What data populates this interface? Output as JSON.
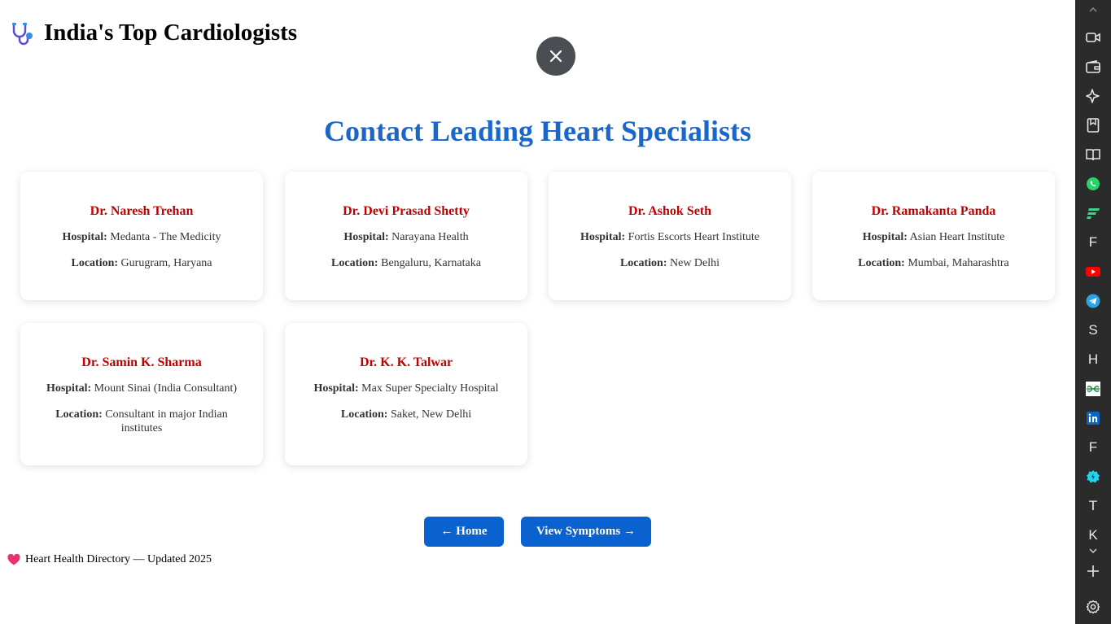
{
  "header": {
    "title": "India's Top Cardiologists"
  },
  "main": {
    "section_title": "Contact Leading Heart Specialists"
  },
  "labels": {
    "hospital": "Hospital:",
    "location": "Location:"
  },
  "doctors": [
    {
      "name": "Dr. Naresh Trehan",
      "hospital": "Medanta - The Medicity",
      "location": "Gurugram, Haryana"
    },
    {
      "name": "Dr. Devi Prasad Shetty",
      "hospital": "Narayana Health",
      "location": "Bengaluru, Karnataka"
    },
    {
      "name": "Dr. Ashok Seth",
      "hospital": "Fortis Escorts Heart Institute",
      "location": "New Delhi"
    },
    {
      "name": "Dr. Ramakanta Panda",
      "hospital": "Asian Heart Institute",
      "location": "Mumbai, Maharashtra"
    },
    {
      "name": "Dr. Samin K. Sharma",
      "hospital": "Mount Sinai (India Consultant)",
      "location": "Consultant in major Indian institutes"
    },
    {
      "name": "Dr. K. K. Talwar",
      "hospital": "Max Super Specialty Hospital",
      "location": "Saket, New Delhi"
    }
  ],
  "nav": {
    "home": "← Home",
    "symptoms": "View Symptoms →"
  },
  "footer": {
    "text": "Heart Health Directory — Updated 2025"
  },
  "colors": {
    "title_blue": "#1a66c9",
    "doctor_red": "#c00000",
    "button_blue": "#0a62d0",
    "sidebar_bg": "#2b2b2b"
  },
  "sidebar": {
    "letters": {
      "f1": "F",
      "s": "S",
      "h": "H",
      "f2": "F",
      "t": "T",
      "k": "K"
    },
    "icons": [
      "chevron-up-icon",
      "video-icon",
      "wallet-icon",
      "sparkle-icon",
      "bookmark-icon",
      "reader-icon",
      "whatsapp-icon",
      "flash-icon",
      "youtube-icon",
      "telegram-icon",
      "geeksforgeeks-icon",
      "linkedin-icon",
      "badge-icon",
      "chevron-down-icon",
      "plus-icon",
      "settings-icon"
    ]
  }
}
